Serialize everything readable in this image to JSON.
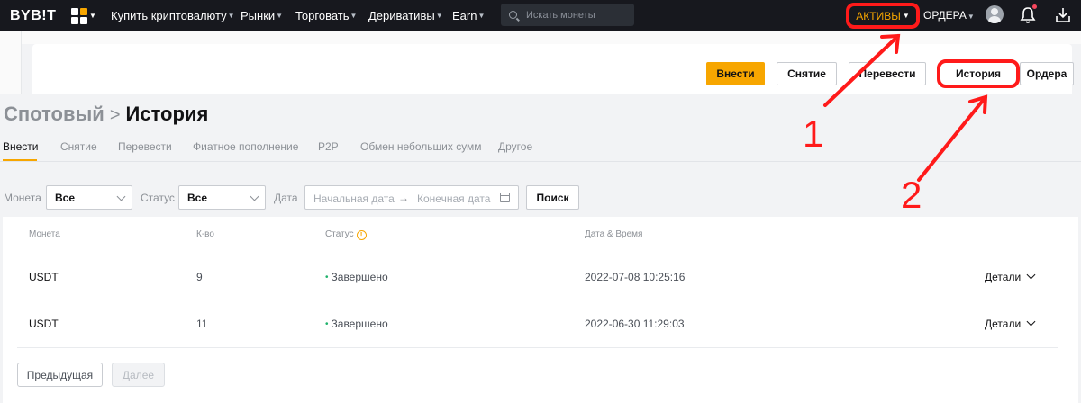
{
  "topnav": {
    "logo": "BYB!T",
    "items": [
      {
        "label": "Купить криптовалюту"
      },
      {
        "label": "Рынки"
      },
      {
        "label": "Торговать"
      },
      {
        "label": "Деривативы"
      },
      {
        "label": "Earn"
      }
    ],
    "search_placeholder": "Искать монеты",
    "assets_label": "АКТИВЫ",
    "orders_label": "ОРДЕРА"
  },
  "actions": {
    "deposit": "Внести",
    "withdraw": "Снятие",
    "transfer": "Перевести",
    "history": "История",
    "orders": "Ордера"
  },
  "breadcrumb": {
    "parent": "Спотовый",
    "separator": ">",
    "current": "История"
  },
  "tabs": [
    {
      "label": "Внести",
      "active": true
    },
    {
      "label": "Снятие"
    },
    {
      "label": "Перевести"
    },
    {
      "label": "Фиатное пополнение"
    },
    {
      "label": "P2P"
    },
    {
      "label": "Обмен небольших сумм"
    },
    {
      "label": "Другое"
    }
  ],
  "filters": {
    "coin_label": "Монета",
    "coin_value": "Все",
    "status_label": "Статус",
    "status_value": "Все",
    "date_label": "Дата",
    "start_placeholder": "Начальная дата",
    "arrow": "→",
    "end_placeholder": "Конечная дата",
    "search_button": "Поиск"
  },
  "table": {
    "headers": [
      "Монета",
      "К-во",
      "Статус",
      "Дата & Время"
    ],
    "info_glyph": "!",
    "rows": [
      {
        "coin": "USDT",
        "qty": "9",
        "status": "Завершено",
        "datetime": "2022-07-08 10:25:16",
        "details": "Детали"
      },
      {
        "coin": "USDT",
        "qty": "11",
        "status": "Завершено",
        "datetime": "2022-06-30 11:29:03",
        "details": "Детали"
      }
    ]
  },
  "pagination": {
    "prev": "Предыдущая",
    "next": "Далее"
  },
  "annotations": {
    "marker1": "1",
    "marker2": "2",
    "color": "#ff1a1a"
  },
  "colors": {
    "accent": "#f7a600",
    "nav_bg": "#17181e",
    "success": "#20b26c"
  }
}
